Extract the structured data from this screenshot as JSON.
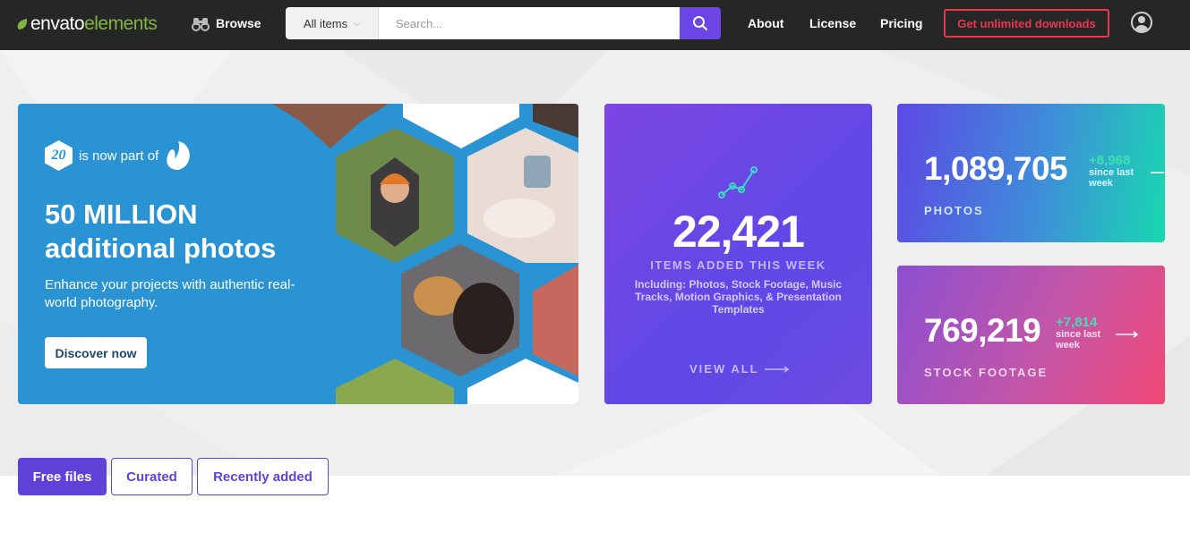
{
  "nav": {
    "logo_part1": "envato",
    "logo_part2": "elements",
    "browse": "Browse",
    "category": "All items",
    "search_placeholder": "Search...",
    "links": [
      "About",
      "License",
      "Pricing"
    ],
    "cta": "Get unlimited downloads"
  },
  "promo": {
    "badge_number": "20",
    "badge_text": "is now part of",
    "title_line1": "50 MILLION",
    "title_line2": "additional photos",
    "subtitle": "Enhance your projects with authentic real-world photography.",
    "button": "Discover now"
  },
  "stats": {
    "weekly": {
      "number": "22,421",
      "label": "ITEMS ADDED THIS WEEK",
      "including": "Including: Photos, Stock Footage, Music Tracks, Motion Graphics, & Presentation Templates",
      "view_all": "VIEW ALL"
    },
    "photos": {
      "number": "1,089,705",
      "delta": "+8,968",
      "since": "since last week",
      "label": "PHOTOS"
    },
    "footage": {
      "number": "769,219",
      "delta": "+7,814",
      "since": "since last week",
      "label": "STOCK FOOTAGE"
    }
  },
  "tabs": [
    "Free files",
    "Curated",
    "Recently added"
  ],
  "colors": {
    "nav_bg": "#262626",
    "accent": "#6b45e6",
    "cta": "#e8384f",
    "promo_bg": "#2a93d4",
    "delta": "#3fe0b3"
  }
}
